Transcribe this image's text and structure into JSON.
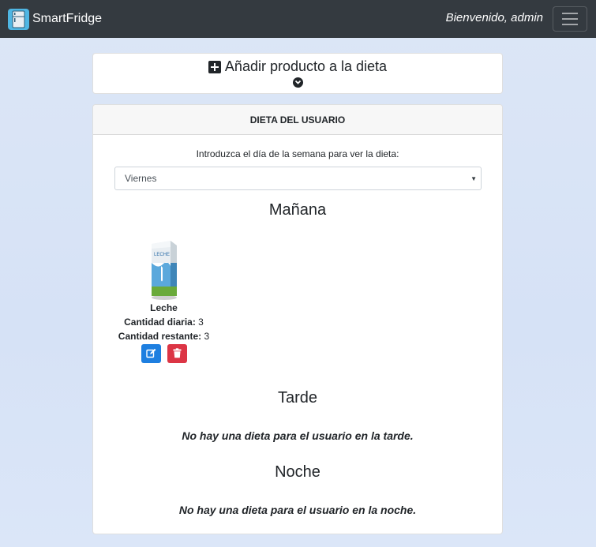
{
  "navbar": {
    "brand": "SmartFridge",
    "welcome": "Bienvenido, admin",
    "icons": {
      "logo": "fridge-logo-icon",
      "menu": "hamburger-menu-icon"
    }
  },
  "add_card": {
    "title": "Añadir producto a la dieta",
    "icons": {
      "plus": "plus-square-icon",
      "expand": "chevron-circle-down-icon"
    }
  },
  "diet_card": {
    "header": "DIETA DEL USUARIO",
    "prompt": "Introduzca el día de la semana para ver la dieta:",
    "day_select": {
      "value": "Viernes"
    },
    "sections": {
      "morning": {
        "title": "Mañana",
        "products": [
          {
            "name": "Leche",
            "daily_label": "Cantidad diaria:",
            "daily_value": "3",
            "remaining_label": "Cantidad restante:",
            "remaining_value": "3",
            "icons": {
              "image": "milk-carton-icon",
              "edit": "edit-icon",
              "delete": "trash-icon"
            }
          }
        ]
      },
      "afternoon": {
        "title": "Tarde",
        "message": "No hay una dieta para el usuario en la tarde."
      },
      "night": {
        "title": "Noche",
        "message": "No hay una dieta para el usuario en la noche."
      }
    }
  },
  "colors": {
    "navbar": "#343a40",
    "edit_button": "#1e7fe0",
    "delete_button": "#dc3545",
    "logo": "#4fb6e3"
  }
}
